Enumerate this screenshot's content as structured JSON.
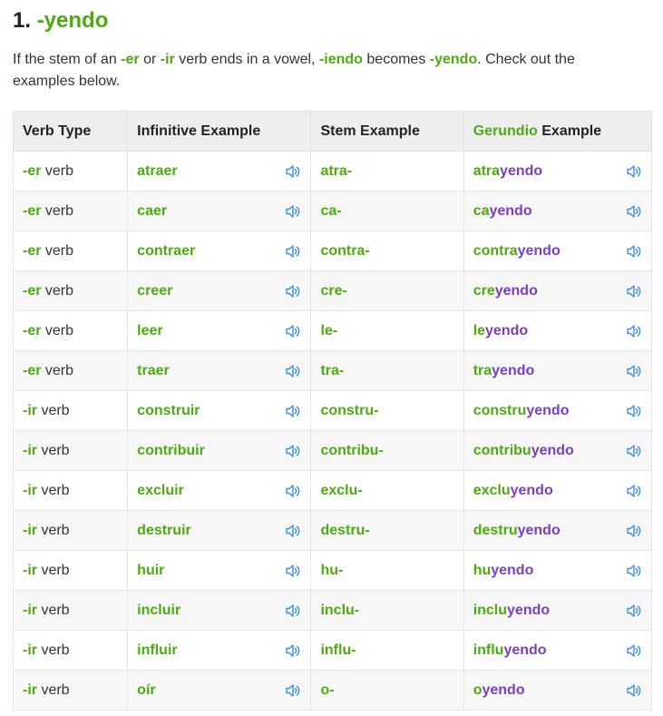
{
  "heading": {
    "number": "1.",
    "suffix": "-yendo"
  },
  "intro": {
    "t1": "If the stem of an ",
    "er": "-er",
    "t2": " or ",
    "ir": "-ir",
    "t3": " verb ends in a vowel, ",
    "iendo": "-iendo",
    "t4": " becomes ",
    "yendo": "-yendo",
    "t5": ". Check out the examples below."
  },
  "table": {
    "headers": {
      "verb_type": "Verb Type",
      "infinitive": "Infinitive Example",
      "stem": "Stem Example",
      "gerundio_word": "Gerundio",
      "gerundio_rest": " Example"
    },
    "rows": [
      {
        "ending": "-er",
        "type_word": " verb",
        "infinitive": "atraer",
        "stem": "atra-",
        "g_stem": "atra",
        "g_end": "yendo"
      },
      {
        "ending": "-er",
        "type_word": " verb",
        "infinitive": "caer",
        "stem": "ca-",
        "g_stem": "ca",
        "g_end": "yendo"
      },
      {
        "ending": "-er",
        "type_word": " verb",
        "infinitive": "contraer",
        "stem": "contra-",
        "g_stem": "contra",
        "g_end": "yendo"
      },
      {
        "ending": "-er",
        "type_word": " verb",
        "infinitive": "creer",
        "stem": "cre-",
        "g_stem": "cre",
        "g_end": "yendo"
      },
      {
        "ending": "-er",
        "type_word": " verb",
        "infinitive": "leer",
        "stem": "le-",
        "g_stem": "le",
        "g_end": "yendo"
      },
      {
        "ending": "-er",
        "type_word": " verb",
        "infinitive": "traer",
        "stem": "tra-",
        "g_stem": "tra",
        "g_end": "yendo"
      },
      {
        "ending": "-ir",
        "type_word": " verb",
        "infinitive": "construir",
        "stem": "constru-",
        "g_stem": "constru",
        "g_end": "yendo"
      },
      {
        "ending": "-ir",
        "type_word": " verb",
        "infinitive": "contribuir",
        "stem": "contribu-",
        "g_stem": "contribu",
        "g_end": "yendo"
      },
      {
        "ending": "-ir",
        "type_word": " verb",
        "infinitive": "excluir",
        "stem": "exclu-",
        "g_stem": "exclu",
        "g_end": "yendo"
      },
      {
        "ending": "-ir",
        "type_word": " verb",
        "infinitive": "destruir",
        "stem": "destru-",
        "g_stem": "destru",
        "g_end": "yendo"
      },
      {
        "ending": "-ir",
        "type_word": " verb",
        "infinitive": "huir",
        "stem": "hu-",
        "g_stem": "hu",
        "g_end": "yendo"
      },
      {
        "ending": "-ir",
        "type_word": " verb",
        "infinitive": "incluir",
        "stem": "inclu-",
        "g_stem": "inclu",
        "g_end": "yendo"
      },
      {
        "ending": "-ir",
        "type_word": " verb",
        "infinitive": "influir",
        "stem": "influ-",
        "g_stem": "influ",
        "g_end": "yendo"
      },
      {
        "ending": "-ir",
        "type_word": " verb",
        "infinitive": "oír",
        "stem": "o-",
        "g_stem": "o",
        "g_end": "yendo"
      }
    ]
  },
  "icons": {
    "audio": "speaker-icon"
  },
  "colors": {
    "green": "#4cab0e",
    "purple": "#7b3fc4",
    "icon_blue": "#3a8ee6"
  }
}
